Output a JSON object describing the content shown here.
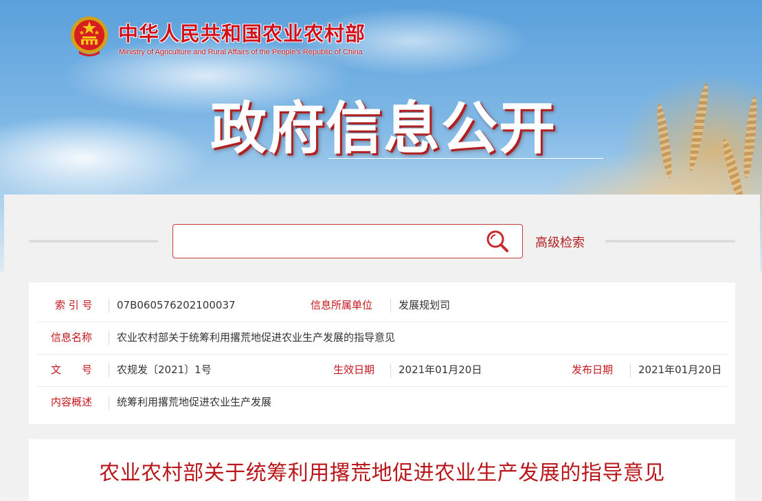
{
  "header": {
    "site_title": "中华人民共和国农业农村部",
    "site_subtitle": "Ministry of Agriculture and Rural Affairs of the People's Republic of China",
    "section_title": "政府信息公开",
    "emblem_icon": "national-emblem-icon"
  },
  "search": {
    "placeholder": "",
    "button_icon": "search-icon",
    "advanced_label": "高级检索"
  },
  "info": {
    "index_label": "索 引 号",
    "index_value": "07B060576202100037",
    "unit_label": "信息所属单位",
    "unit_value": "发展规划司",
    "name_label": "信息名称",
    "name_value": "农业农村部关于统筹利用撂荒地促进农业生产发展的指导意见",
    "docno_label": "文　　号",
    "docno_value": "农规发〔2021〕1号",
    "effective_label": "生效日期",
    "effective_value": "2021年01月20日",
    "publish_label": "发布日期",
    "publish_value": "2021年01月20日",
    "summary_label": "内容概述",
    "summary_value": "统筹利用撂荒地促进农业生产发展"
  },
  "document": {
    "title": "农业农村部关于统筹利用撂荒地促进农业生产发展的指导意见"
  },
  "colors": {
    "brand_red": "#d0111b",
    "label_red": "#c4161c",
    "title_red": "#b8171b",
    "sky_blue": "#5aa0db"
  }
}
